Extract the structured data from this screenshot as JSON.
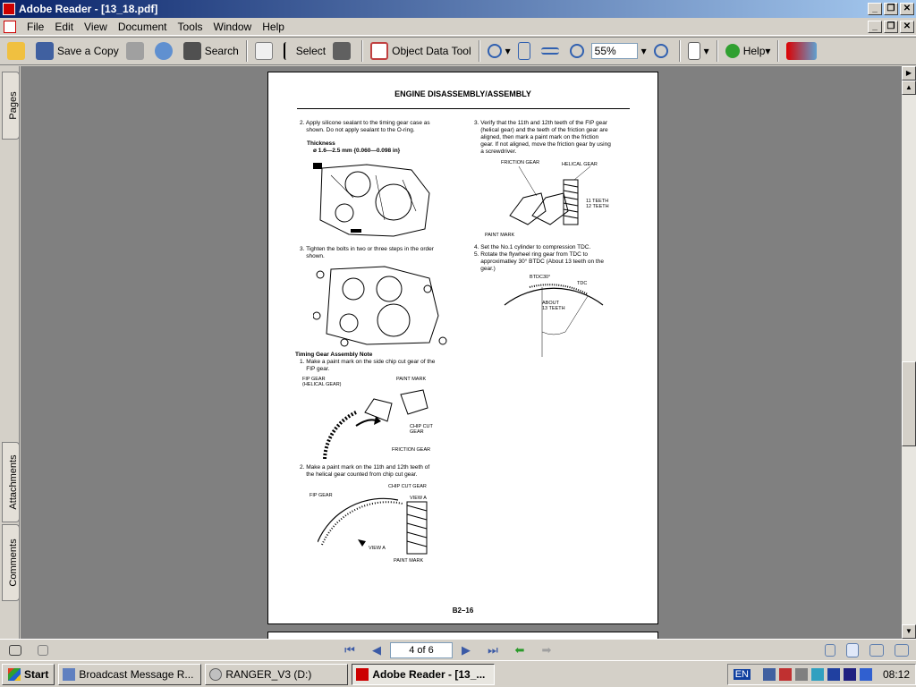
{
  "window": {
    "title": "Adobe Reader - [13_18.pdf]"
  },
  "menu": [
    "File",
    "Edit",
    "View",
    "Document",
    "Tools",
    "Window",
    "Help"
  ],
  "toolbar": {
    "save_copy": "Save a Copy",
    "search": "Search",
    "select": "Select",
    "object_data_tool": "Object Data Tool",
    "zoom": "55%",
    "help": "Help"
  },
  "side_tabs": {
    "pages": "Pages",
    "attachments": "Attachments",
    "comments": "Comments"
  },
  "document": {
    "heading": "ENGINE DISASSEMBLY/ASSEMBLY",
    "left": {
      "step2": "2. Apply silicone sealant to the timing gear case as\n    shown. Do not apply sealant to the O-ring.",
      "thickness_label": "Thickness",
      "thickness_value": "ø 1.6—2.5 mm {0.060—0.098 in}",
      "step3": "3. Tighten the bolts in two or three steps in the order\n    shown.",
      "note_title": "Timing Gear Assembly Note",
      "note1": "1. Make a paint mark on the side chip cut gear of the\n    FIP gear.",
      "fig3_labels": {
        "fip": "FIP GEAR\n(HELICAL GEAR)",
        "paint": "PAINT MARK",
        "chip": "CHIP CUT\nGEAR",
        "friction": "FRICTION GEAR"
      },
      "note2": "2. Make a paint mark on the 11th and 12th teeth of\n    the helical gear counted from chip cut gear.",
      "fig4_labels": {
        "chip": "CHIP CUT GEAR",
        "fip": "FIP GEAR",
        "viewa": "VIEW A",
        "viewa2": "VIEW A",
        "paint": "PAINT MARK"
      }
    },
    "right": {
      "step3": "3. Verify that the 11th and 12th teeth of the FIP gear\n    (helical gear) and the teeth of the friction gear are\n    aligned, then mark a paint mark on the friction\n    gear. If not aligned, move the friction gear by using\n    a screwdriver.",
      "fig_labels": {
        "friction": "FRICTION GEAR",
        "helical": "HELICAL GEAR",
        "teeth11": "11 TEETH",
        "teeth12": "12 TEETH",
        "paint": "PAINT MARK"
      },
      "step4": "4. Set the No.1 cylinder to compression TDC.",
      "step5": "5. Rotate the flywheel ring gear from TDC to\n    approximatley 30° BTDC (About 13 teeth on the\n    gear.)",
      "fig2_labels": {
        "btdc": "BTDC30°",
        "tdc": "TDC",
        "about": "ABOUT\n13 TEETH"
      }
    },
    "page_number": "B2–16"
  },
  "navigation": {
    "page_indicator": "4 of 6"
  },
  "taskbar": {
    "start": "Start",
    "tasks": [
      "Broadcast Message R...",
      "RANGER_V3 (D:)",
      "Adobe Reader - [13_..."
    ],
    "lang": "EN",
    "clock": "08:12"
  }
}
